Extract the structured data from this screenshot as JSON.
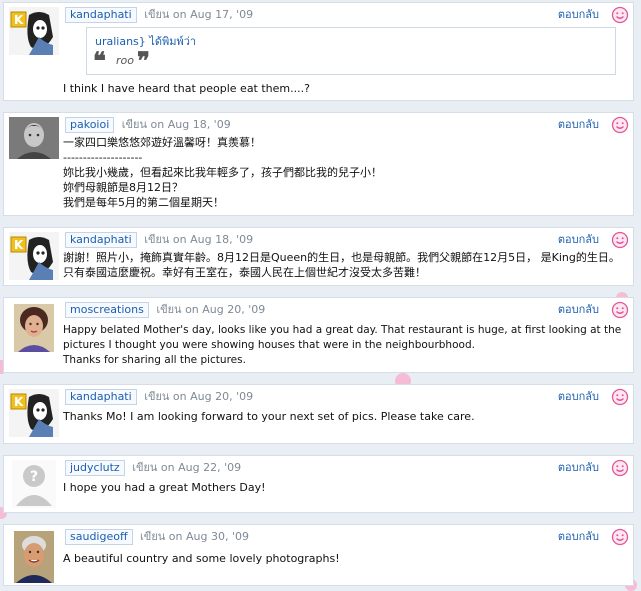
{
  "reply_label": "ตอบกลับ",
  "icons": {
    "reply": "smiley-icon"
  },
  "colors": {
    "link": "#1c5fb0",
    "meta": "#7f8a96",
    "accent": "#e2559a"
  },
  "comments": [
    {
      "user": "kandaphati",
      "meta": "เขียน on Aug 17, '09",
      "quote": {
        "author_line": "uralians} ได้พิมพ์ว่า",
        "text": "roo"
      },
      "lines": [
        "I think I have heard that people eat them....?"
      ]
    },
    {
      "user": "pakoioi",
      "meta": "เขียน on Aug 18, '09",
      "lines": [
        "一家四口樂悠悠郊遊好溫馨呀！真羨慕！",
        "--------------------",
        "妳比我小幾歲，但看起來比我年輕多了，孩子們都比我的兒子小！",
        "妳們母親節是8月12日？",
        "我們是每年5月的第二個星期天！"
      ]
    },
    {
      "user": "kandaphati",
      "meta": "เขียน on Aug 18, '09",
      "lines": [
        "謝謝！照片小，掩飾真實年齡。8月12日是Queen的生日，也是母親節。我們父親節在12月5日， 是King的生日。只有泰國這麼慶祝。幸好有王室在，泰國人民在上個世紀才沒受太多苦難！"
      ]
    },
    {
      "user": "moscreations",
      "meta": "เขียน on Aug 20, '09",
      "lines": [
        "Happy belated Mother's day, looks like you had a great day. That restaurant is huge, at first looking at the pictures I thought you were showing houses that were in the neighbourbhood.",
        "Thanks for sharing all the pictures."
      ]
    },
    {
      "user": "kandaphati",
      "meta": "เขียน on Aug 20, '09",
      "lines": [
        "Thanks Mo! I am looking forward to your next set of pics. Please take care."
      ]
    },
    {
      "user": "judyclutz",
      "meta": "เขียน on Aug 22, '09",
      "lines": [
        "I hope you had a great Mothers Day!"
      ]
    },
    {
      "user": "saudigeoff",
      "meta": "เขียน on Aug 30, '09",
      "lines": [
        "A beautiful country and some lovely photographs!"
      ]
    }
  ]
}
